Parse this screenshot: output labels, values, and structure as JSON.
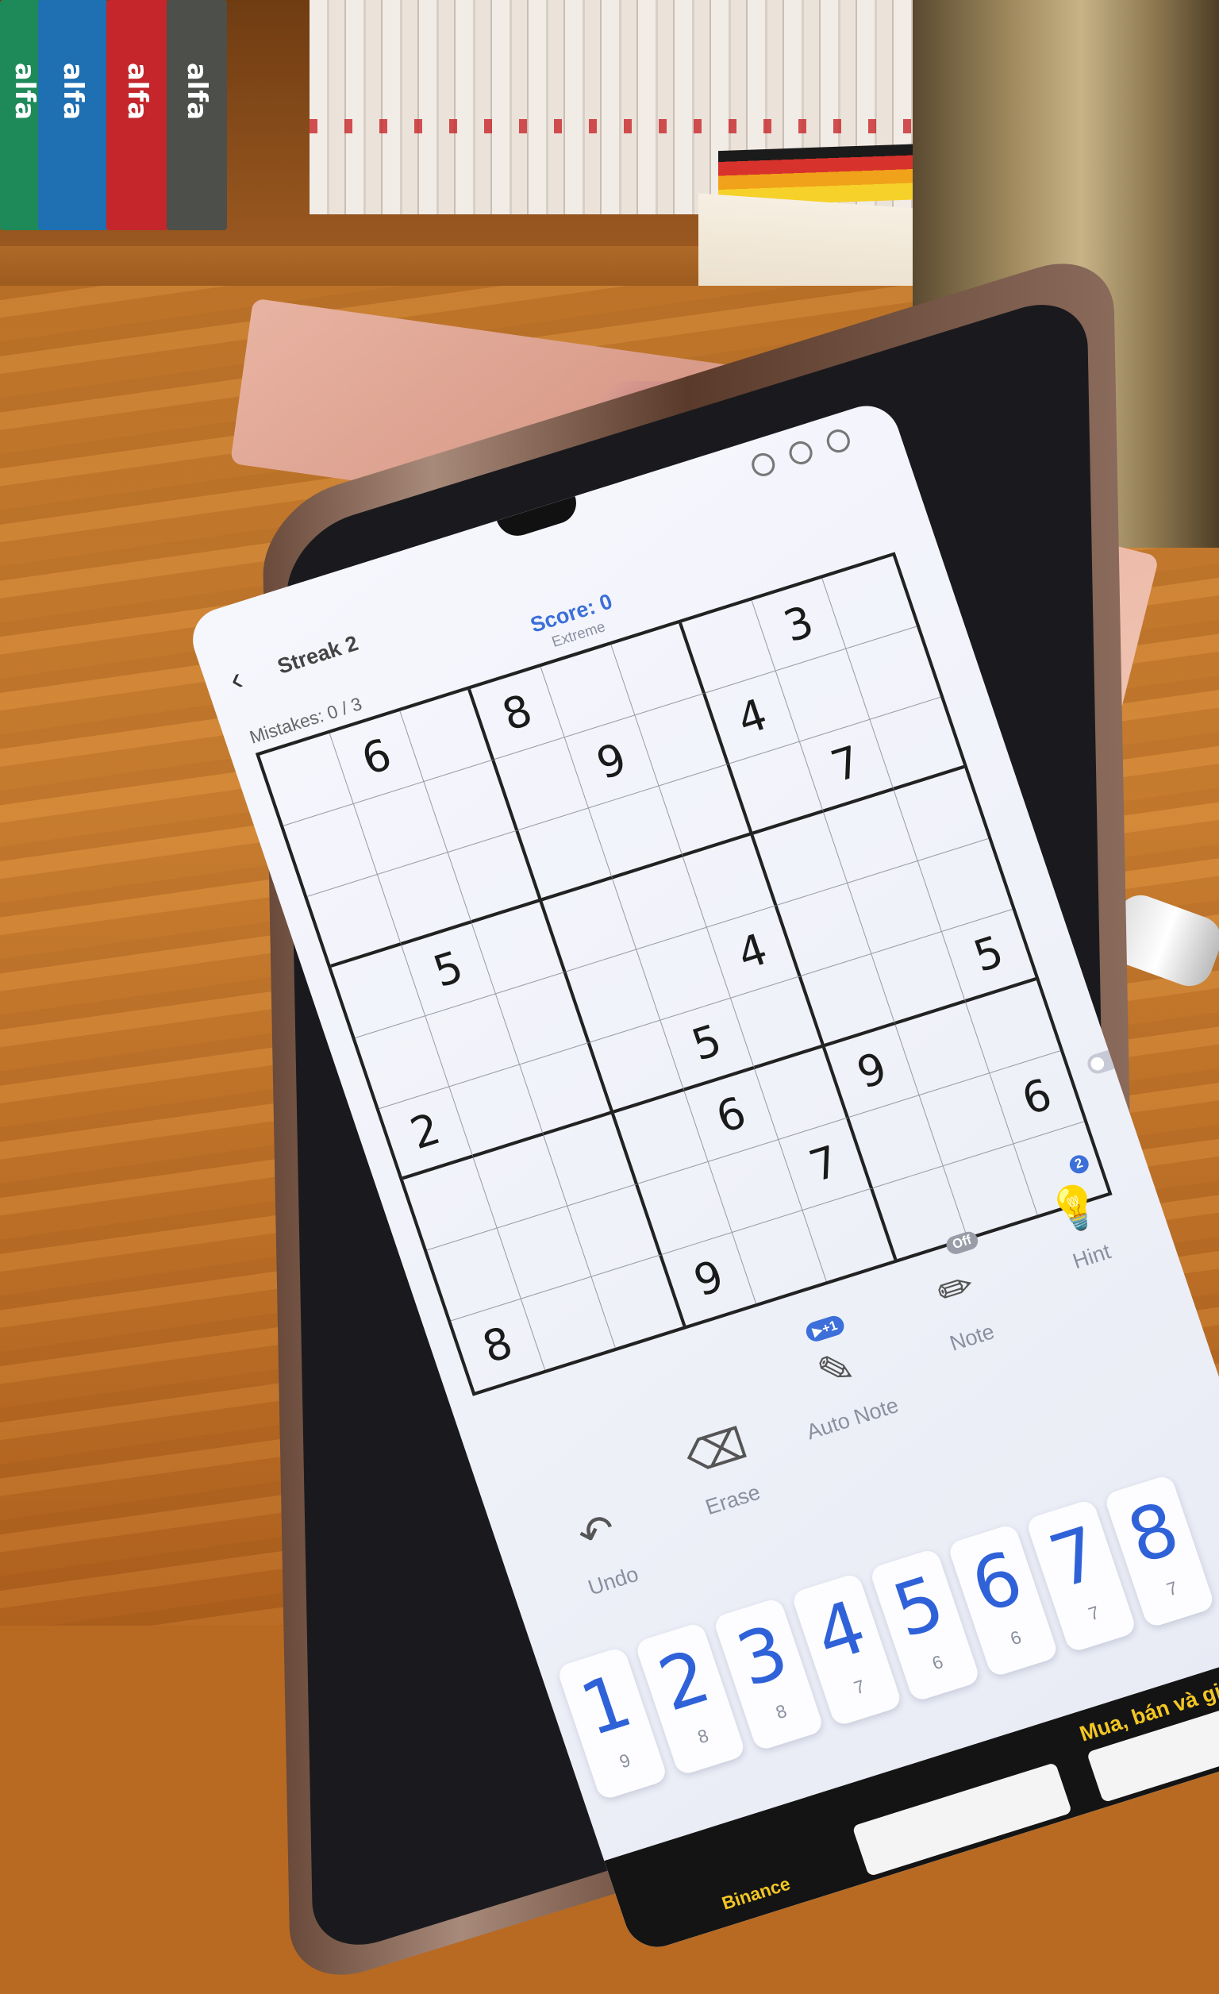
{
  "scene": {
    "book_spine_text": "alfa",
    "books": [
      {
        "color": "#1e8a5a"
      },
      {
        "color": "#1f6fb3"
      },
      {
        "color": "#c4262c"
      },
      {
        "color": "#4d4f4a"
      }
    ]
  },
  "app": {
    "accent_color": "#3c6fd9",
    "header": {
      "back_icon": "chevron-left-icon",
      "streak": "Streak 2",
      "score": "Score: 0",
      "difficulty": "Extreme"
    },
    "mistakes": "Mistakes: 0 / 3",
    "grid": [
      [
        "",
        "6",
        "",
        "8",
        "",
        "",
        "",
        "3",
        ""
      ],
      [
        "",
        "",
        "",
        "",
        "9",
        "",
        "4",
        "",
        ""
      ],
      [
        "",
        "",
        "",
        "",
        "",
        "",
        "",
        "7",
        ""
      ],
      [
        "",
        "5",
        "",
        "",
        "",
        "",
        "",
        "",
        ""
      ],
      [
        "",
        "",
        "",
        "",
        "",
        "4",
        "",
        "",
        ""
      ],
      [
        "2",
        "",
        "",
        "",
        "5",
        "",
        "",
        "",
        "5"
      ],
      [
        "",
        "",
        "",
        "",
        "6",
        "",
        "9",
        "",
        ""
      ],
      [
        "",
        "",
        "",
        "",
        "",
        "7",
        "",
        "",
        "6"
      ],
      [
        "8",
        "",
        "",
        "9",
        "",
        "",
        "",
        "",
        ""
      ]
    ],
    "tools": [
      {
        "label": "Undo",
        "icon": "undo-icon"
      },
      {
        "label": "Erase",
        "icon": "eraser-icon"
      },
      {
        "label": "Auto Note",
        "icon": "auto-note-icon",
        "badge": "▶+1"
      },
      {
        "label": "Note",
        "icon": "pencil-icon",
        "badge": "Off"
      },
      {
        "label": "Hint",
        "icon": "lightbulb-icon",
        "badge": "2"
      }
    ],
    "numpad": [
      {
        "num": "1",
        "count": "9"
      },
      {
        "num": "2",
        "count": "8"
      },
      {
        "num": "3",
        "count": "8"
      },
      {
        "num": "4",
        "count": "7"
      },
      {
        "num": "5",
        "count": "6"
      },
      {
        "num": "6",
        "count": "6"
      },
      {
        "num": "7",
        "count": "7"
      },
      {
        "num": "8",
        "count": "7"
      }
    ],
    "ad": {
      "headline": "Mua, bán và giao dịch",
      "action": "Binance"
    }
  }
}
